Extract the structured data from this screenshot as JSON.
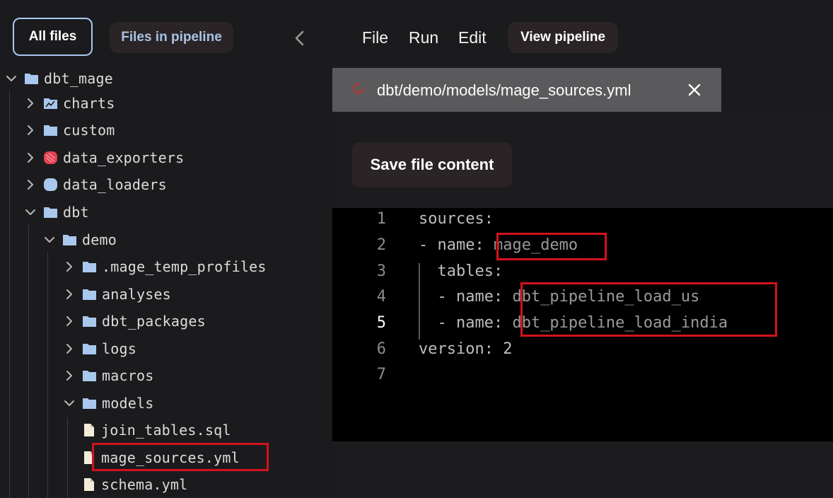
{
  "sidebar": {
    "tabs": {
      "all_files": "All files",
      "files_in_pipeline": "Files in pipeline"
    },
    "tree": [
      {
        "label": "dbt_mage",
        "icon": "folder-icon",
        "expanded": true
      },
      {
        "label": "charts",
        "icon": "chart-icon",
        "expanded": false
      },
      {
        "label": "custom",
        "icon": "folder-icon",
        "expanded": false
      },
      {
        "label": "data_exporters",
        "icon": "data-exporters-icon",
        "expanded": false
      },
      {
        "label": "data_loaders",
        "icon": "data-loaders-icon",
        "expanded": false
      },
      {
        "label": "dbt",
        "icon": "folder-icon",
        "expanded": true
      },
      {
        "label": "demo",
        "icon": "folder-icon",
        "expanded": true
      },
      {
        "label": ".mage_temp_profiles",
        "icon": "folder-icon",
        "expanded": false
      },
      {
        "label": "analyses",
        "icon": "folder-icon",
        "expanded": false
      },
      {
        "label": "dbt_packages",
        "icon": "folder-icon",
        "expanded": false
      },
      {
        "label": "logs",
        "icon": "folder-icon",
        "expanded": false
      },
      {
        "label": "macros",
        "icon": "folder-icon",
        "expanded": false
      },
      {
        "label": "models",
        "icon": "folder-icon",
        "expanded": true
      },
      {
        "label": "join_tables.sql",
        "icon": "file-icon"
      },
      {
        "label": "mage_sources.yml",
        "icon": "file-icon",
        "selected": true
      },
      {
        "label": "schema.yml",
        "icon": "file-icon"
      }
    ]
  },
  "menu": {
    "file": "File",
    "run": "Run",
    "edit": "Edit",
    "view_pipeline": "View pipeline"
  },
  "file_tab": {
    "path": "dbt/demo/models/mage_sources.yml"
  },
  "actions": {
    "save": "Save file content"
  },
  "editor": {
    "active_line": 5,
    "lines": [
      {
        "num": "1",
        "key": "sources:",
        "val": ""
      },
      {
        "num": "2",
        "key": "- name: ",
        "val": "mage_demo"
      },
      {
        "num": "3",
        "key": "  tables:",
        "val": ""
      },
      {
        "num": "4",
        "key": "  - name: ",
        "val": "dbt_pipeline_load_us"
      },
      {
        "num": "5",
        "key": "  - name: ",
        "val": "dbt_pipeline_load_india"
      },
      {
        "num": "6",
        "key": "version: 2",
        "val": ""
      },
      {
        "num": "7",
        "key": "",
        "val": ""
      }
    ]
  },
  "colors": {
    "highlight": "#d2121e",
    "folder": "#a9c8ee",
    "accent_button": "#2a2426"
  }
}
